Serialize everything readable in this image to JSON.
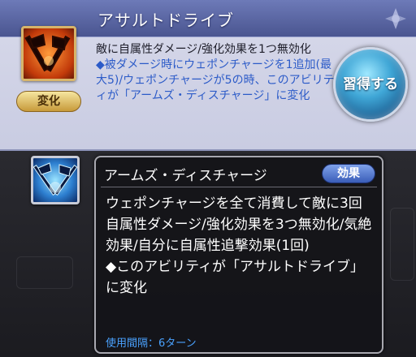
{
  "top": {
    "title": "アサルトドライブ",
    "change_label": "変化",
    "description": "敵に自属性ダメージ/強化効果を1つ無効化",
    "note": "◆被ダメージ時にウェポンチャージを1追加(最大5)/ウェポンチャージが5の時、このアビリティが「アームズ・ディスチャージ」に変化",
    "learn_button": "習得する",
    "icon": "crossed-axes-icon"
  },
  "panel": {
    "title": "アームズ・ディスチャージ",
    "effect_badge": "効果",
    "description": "ウェポンチャージを全て消費して敵に3回自属性ダメージ/強化効果を3つ無効化/気絶効果/自分に自属性追撃効果(1回)",
    "note": "◆このアビリティが「アサルトドライブ」に変化",
    "cooldown": "使用間隔：6ターン",
    "icon": "crossed-weapons-icon"
  },
  "colors": {
    "header": "#505b96",
    "note_text": "#2c5bc8",
    "cooldown_text": "#4aa2ff",
    "learn_button": "#3fa6d6",
    "effect_badge": "#3a5db8",
    "change_badge": "#c79a3a"
  }
}
